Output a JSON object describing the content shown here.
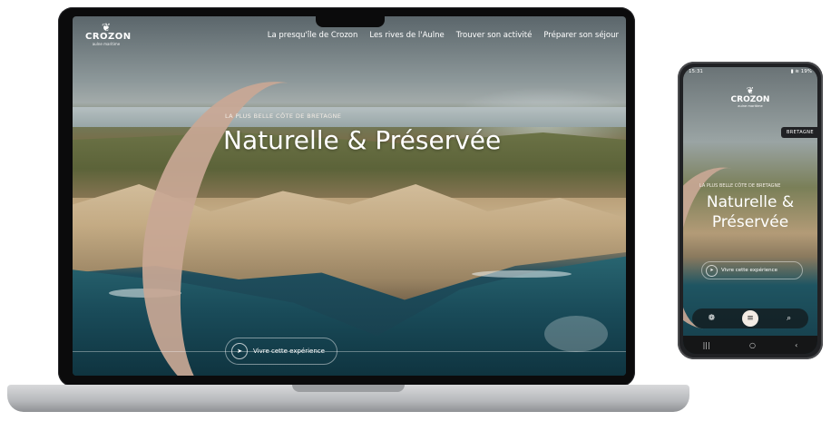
{
  "laptop": {
    "logo": {
      "laurel": "❦",
      "name": "CROZON",
      "sub": "aulne maritime"
    },
    "nav": [
      "La presqu'île de Crozon",
      "Les rives de l'Aulne",
      "Trouver son activité",
      "Préparer son séjour"
    ],
    "hero": {
      "kicker": "LA PLUS BELLE CÔTE DE BRETAGNE",
      "title": "Naturelle & Préservée",
      "cta": "Vivre cette expérience",
      "cta_icon": "navigation-arrow-icon"
    }
  },
  "phone": {
    "status": {
      "time": "15:31",
      "right": "▮ ≋ 19%"
    },
    "logo": {
      "laurel": "❦",
      "name": "CROZON",
      "sub": "aulne maritime"
    },
    "badge": "BRETAGNE",
    "hero": {
      "kicker": "LA PLUS BELLE CÔTE DE BRETAGNE",
      "title": "Naturelle & Préservée",
      "cta": "Vivre cette expérience"
    },
    "toolbar": {
      "left_icon": "❁",
      "menu_icon": "≡",
      "search_icon": "⌕"
    },
    "system_nav": {
      "recent": "|||",
      "home": "○",
      "back": "‹"
    }
  },
  "colors": {
    "brush_accent": "#c9a895",
    "ocean": "#1a4c5a",
    "frame": "#0b0b0c"
  }
}
